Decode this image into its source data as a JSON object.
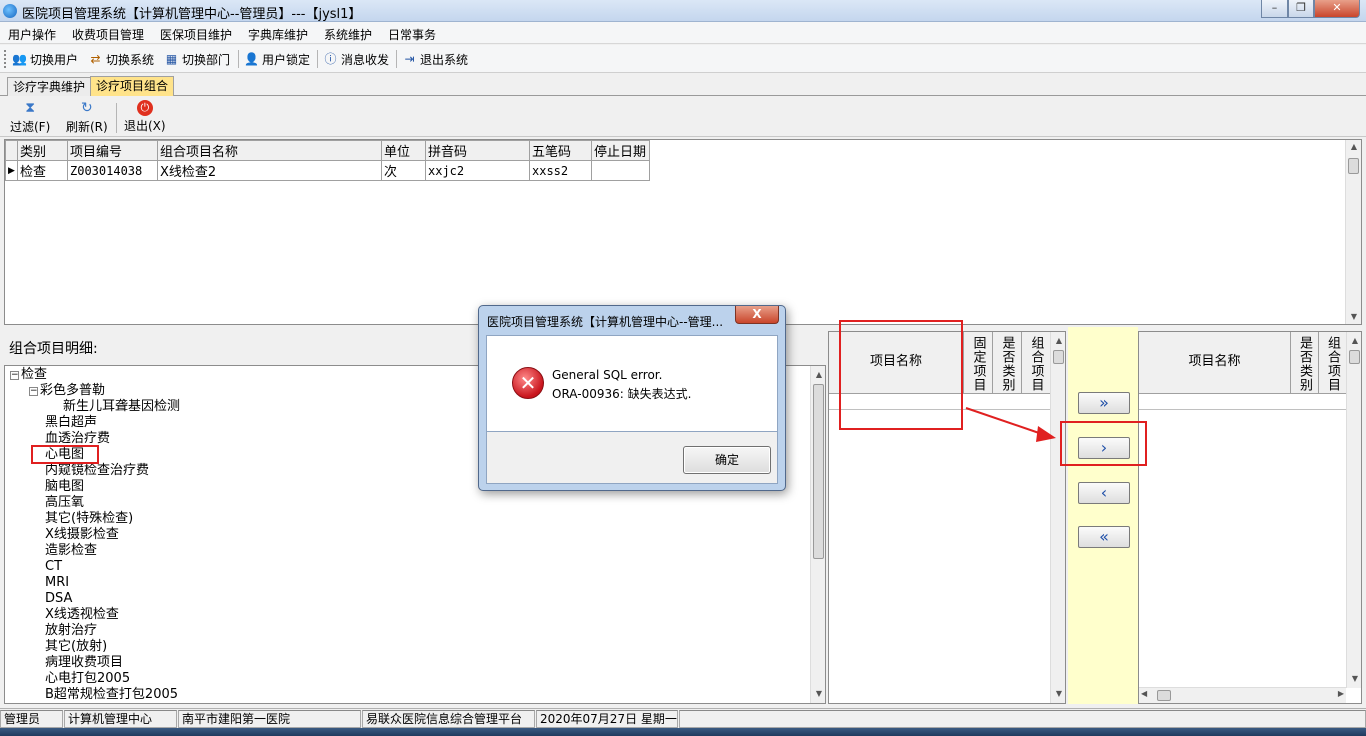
{
  "window": {
    "title": "医院项目管理系统【计算机管理中心--管理员】---【jysl1】"
  },
  "menu": [
    "用户操作",
    "收费项目管理",
    "医保项目维护",
    "字典库维护",
    "系统维护",
    "日常事务"
  ],
  "toolbar": [
    {
      "label": "切换用户",
      "icon": "users-icon"
    },
    {
      "label": "切换系统",
      "icon": "switch-system-icon"
    },
    {
      "label": "切换部门",
      "icon": "department-icon"
    },
    {
      "label": "用户锁定",
      "icon": "lock-user-icon"
    },
    {
      "label": "消息收发",
      "icon": "message-icon"
    },
    {
      "label": "退出系统",
      "icon": "exit-icon"
    }
  ],
  "tabs": [
    {
      "label": "诊疗字典维护",
      "active": false
    },
    {
      "label": "诊疗项目组合",
      "active": true
    }
  ],
  "subtoolbar": [
    {
      "label": "过滤(F)",
      "icon": "filter-icon"
    },
    {
      "label": "刷新(R)",
      "icon": "refresh-icon"
    },
    {
      "label": "退出(X)",
      "icon": "power-icon"
    }
  ],
  "grid": {
    "columns": [
      "类别",
      "项目编号",
      "组合项目名称",
      "单位",
      "拼音码",
      "五笔码",
      "停止日期"
    ],
    "rows": [
      [
        "检查",
        "Z003014038",
        "X线检查2",
        "次",
        "xxjc2",
        "xxss2",
        ""
      ]
    ]
  },
  "detail_label": "组合项目明细:",
  "tree": {
    "root": "检查",
    "child": "彩色多普勒",
    "grandchild": "新生儿耳聋基因检测",
    "items": [
      "黑白超声",
      "血透治疗费",
      "心电图",
      "内窥镜检查治疗费",
      "脑电图",
      "高压氧",
      "其它(特殊检查)",
      "X线摄影检查",
      "造影检查",
      "CT",
      "MRI",
      "DSA",
      "X线透视检查",
      "放射治疗",
      "其它(放射)",
      "病理收费项目",
      "心电打包2005",
      "B超常规检查打包2005"
    ]
  },
  "mid_grid": {
    "col1": "项目名称",
    "col2": "固定项目",
    "col3": "是否类别",
    "col4": "组合项目"
  },
  "move_buttons": [
    "»",
    "›",
    "‹",
    "«"
  ],
  "right_grid": {
    "col1": "项目名称",
    "col2": "是否类别",
    "col3": "组合项目"
  },
  "dialog": {
    "title": "医院项目管理系统【计算机管理中心--管理...",
    "close": "X",
    "line1": "General SQL error.",
    "line2": "ORA-00936: 缺失表达式.",
    "ok": "确定"
  },
  "status": [
    "管理员",
    "计算机管理中心",
    "南平市建阳第一医院",
    "易联众医院信息综合管理平台",
    "2020年07月27日 星期一"
  ],
  "colors": {
    "tab_active": "#ffe38a",
    "move_panel": "#ffffcc",
    "highlight": "#e02020"
  }
}
